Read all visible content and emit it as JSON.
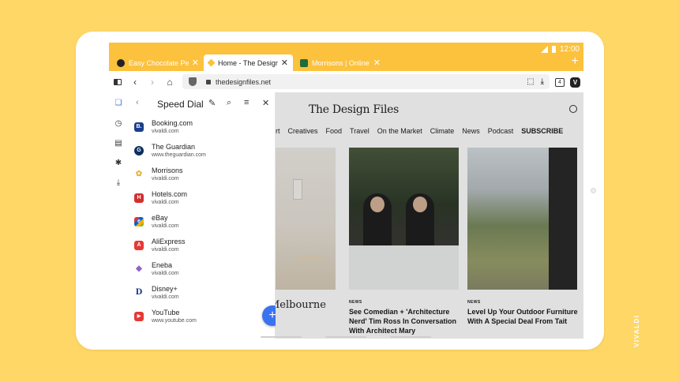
{
  "status": {
    "time": "12:00"
  },
  "tabs": [
    {
      "title": "Easy Chocolate Pe",
      "active": false,
      "fav_color": "#222222"
    },
    {
      "title": "Home - The Design",
      "active": true,
      "fav_color": "#FCC13D"
    },
    {
      "title": "Morrisons | Online",
      "active": false,
      "fav_color": "#1E6B3C"
    }
  ],
  "address_bar": {
    "url": "thedesignfiles.net",
    "tab_count": "4"
  },
  "panel": {
    "title": "Speed Dial",
    "items": [
      {
        "name": "Booking.com",
        "url": "vivaldi.com",
        "fav_color": "#1A3E8C",
        "fav_letter": "B."
      },
      {
        "name": "The Guardian",
        "url": "www.theguardian.com",
        "fav_color": "#0C2F5E",
        "fav_letter": "G"
      },
      {
        "name": "Morrisons",
        "url": "vivaldi.com",
        "fav_color": "#F2C94C",
        "fav_letter": "✿"
      },
      {
        "name": "Hotels.com",
        "url": "vivaldi.com",
        "fav_color": "#D32F2F",
        "fav_letter": "H"
      },
      {
        "name": "eBay",
        "url": "vivaldi.com",
        "fav_color": "#2E7D32",
        "fav_letter": "e"
      },
      {
        "name": "AliExpress",
        "url": "vivaldi.com",
        "fav_color": "#E53935",
        "fav_letter": "A"
      },
      {
        "name": "Eneba",
        "url": "vivaldi.com",
        "fav_color": "#8E63CE",
        "fav_letter": "◆"
      },
      {
        "name": "Disney+",
        "url": "vivaldi.com",
        "fav_color": "#1E3A8A",
        "fav_letter": "D"
      },
      {
        "name": "YouTube",
        "url": "www.youtube.com",
        "fav_color": "#E53935",
        "fav_letter": "▶"
      }
    ]
  },
  "site": {
    "title": "The Design Files",
    "menu": [
      "rt",
      "Creatives",
      "Food",
      "Travel",
      "On the Market",
      "Climate",
      "News",
      "Podcast",
      "SUBSCRIBE"
    ],
    "left_headline": "Melbourne",
    "articles": [
      {
        "tag": "NEWS",
        "headline": "See Comedian + 'Architecture Nerd' Tim Ross In Conversation With Architect Mary"
      },
      {
        "tag": "NEWS",
        "headline": "Level Up Your Outdoor Furniture With A Special Deal From Tait"
      }
    ]
  },
  "brand": "VIVALDI",
  "colors": {
    "background": "#FFD766",
    "tabbar": "#FCC13D",
    "fab": "#3B72F0"
  }
}
